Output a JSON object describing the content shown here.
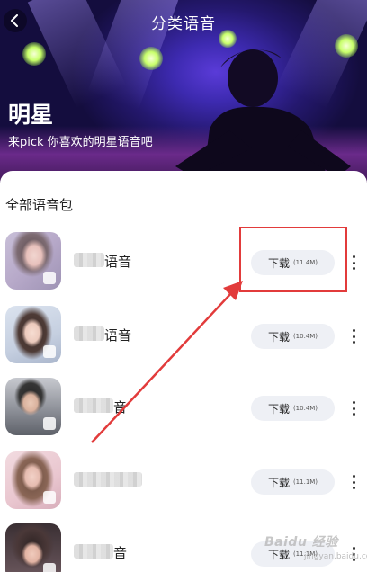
{
  "header": {
    "title": "分类语音",
    "back_icon": "chevron-left-icon"
  },
  "hero": {
    "heading": "明星",
    "subtitle": "来pick 你喜欢的明星语音吧"
  },
  "section": {
    "title": "全部语音包"
  },
  "download_label": "下载",
  "items": [
    {
      "name": "语音",
      "size": "(11.4M)"
    },
    {
      "name": "语音",
      "size": "(10.4M)"
    },
    {
      "name": "音",
      "size": "(10.4M)"
    },
    {
      "name": "",
      "size": "(11.1M)"
    },
    {
      "name": "音",
      "size": "(11.1M)"
    }
  ],
  "watermark": {
    "brand": "Baidu 经验",
    "url": "jingyan.baidu.com"
  },
  "colors": {
    "annotation": "#e23b3b",
    "button_bg": "#eef0f5",
    "hero_purple": "#3d2ab0"
  }
}
